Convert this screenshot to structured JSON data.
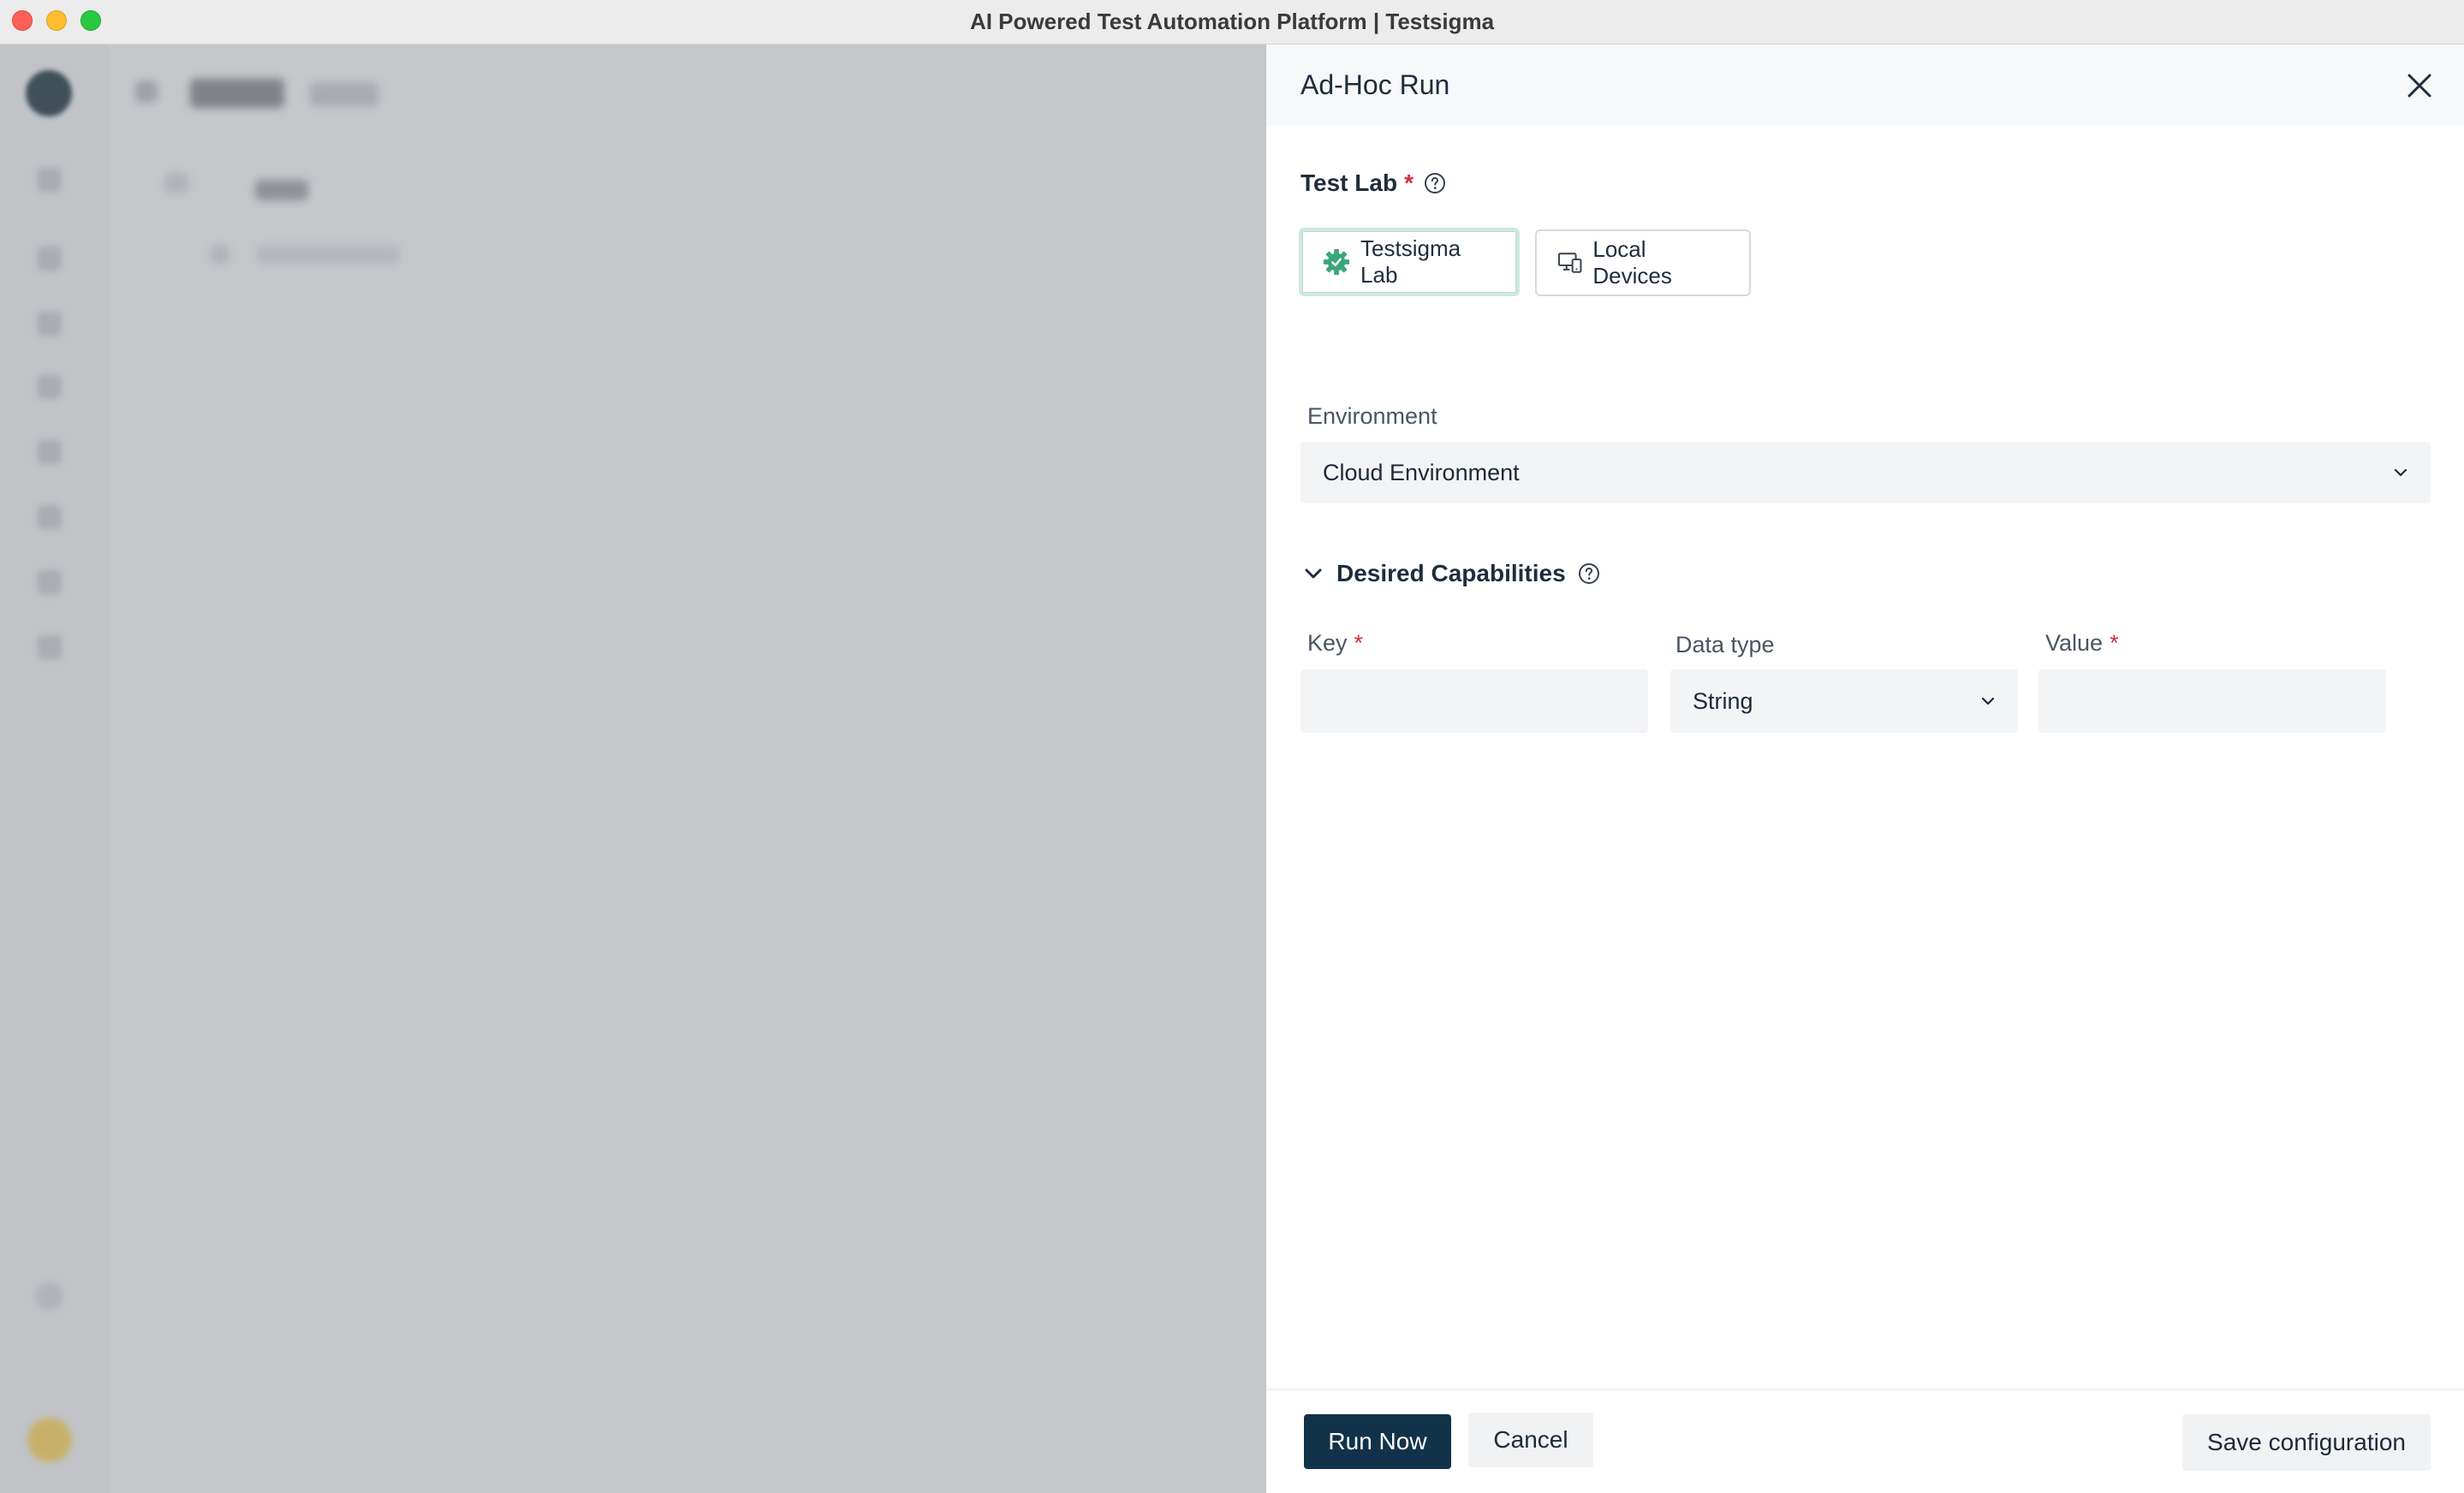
{
  "window": {
    "title": "AI Powered Test Automation Platform | Testsigma"
  },
  "drawer": {
    "title": "Ad-Hoc Run",
    "test_lab": {
      "label": "Test Lab",
      "required_mark": "*",
      "options": [
        {
          "label": "Testsigma Lab",
          "icon": "gear-icon",
          "selected": true
        },
        {
          "label": "Local Devices",
          "icon": "devices-icon",
          "selected": false
        }
      ]
    },
    "environment": {
      "label": "Environment",
      "value": "Cloud Environment"
    },
    "desired_capabilities": {
      "label": "Desired Capabilities",
      "expanded": true,
      "key": {
        "label": "Key",
        "required_mark": "*",
        "value": ""
      },
      "data_type": {
        "label": "Data type",
        "value": "String"
      },
      "value": {
        "label": "Value",
        "required_mark": "*",
        "value": ""
      }
    },
    "footer": {
      "run_now": "Run Now",
      "cancel": "Cancel",
      "save_configuration": "Save configuration"
    }
  },
  "colors": {
    "primary_button": "#12324a",
    "required": "#d0303f",
    "testsigma_green": "#3aa77b",
    "overlay": "#c5c7cb"
  }
}
